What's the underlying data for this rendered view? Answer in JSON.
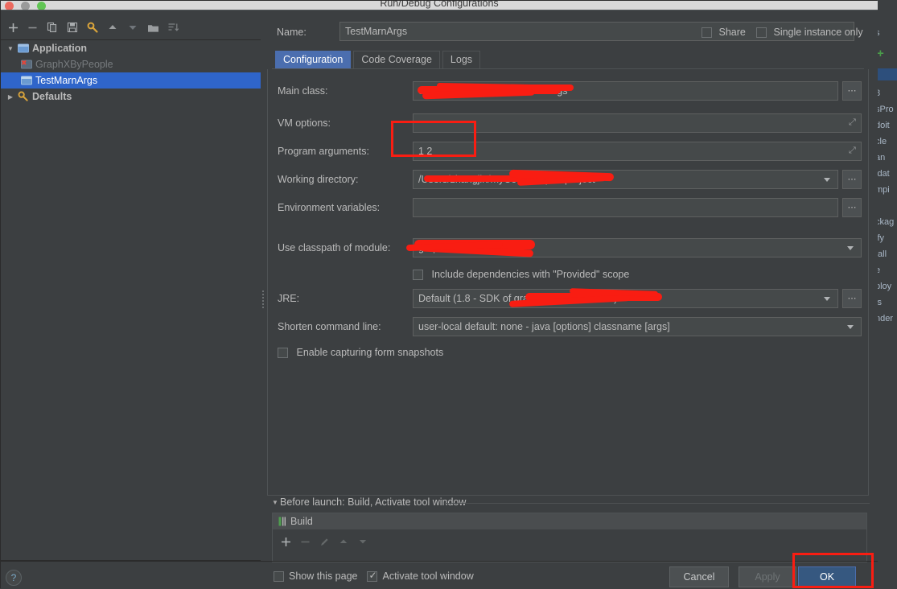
{
  "window": {
    "title": "Run/Debug Configurations",
    "traffic_lights": [
      "close-red",
      "minimize-disabled",
      "zoom-green"
    ]
  },
  "sidebar": {
    "toolbar": [
      {
        "name": "add-configuration-button",
        "glyph": "+"
      },
      {
        "name": "remove-configuration-button",
        "glyph": "−"
      },
      {
        "name": "copy-configuration-button",
        "glyph": "copy"
      },
      {
        "name": "save-configuration-button",
        "glyph": "save"
      },
      {
        "name": "edit-defaults-button",
        "glyph": "wrench"
      },
      {
        "name": "move-up-button",
        "glyph": "up"
      },
      {
        "name": "move-down-button",
        "glyph": "down"
      },
      {
        "name": "move-into-folder-button",
        "glyph": "folder"
      },
      {
        "name": "sort-configurations-button",
        "glyph": "sort"
      }
    ],
    "tree": [
      {
        "label": "Application",
        "level": 0,
        "expanded": true,
        "icon": "application-icon",
        "state": "normal"
      },
      {
        "label": "GraphXByPeople",
        "level": 1,
        "icon": "configuration-error-icon",
        "state": "disabled"
      },
      {
        "label": "TestMarnArgs",
        "level": 1,
        "icon": "configuration-icon",
        "state": "selected"
      },
      {
        "label": "Defaults",
        "level": 0,
        "expanded": false,
        "icon": "wrench-icon",
        "state": "normal"
      }
    ]
  },
  "header": {
    "name_label": "Name:",
    "name_value": "TestMarnArgs",
    "share_label": "Share",
    "share_checked": false,
    "single_instance_label": "Single instance only",
    "single_instance_checked": false
  },
  "tabs": [
    {
      "label": "Configuration",
      "active": true
    },
    {
      "label": "Code Coverage",
      "active": false
    },
    {
      "label": "Logs",
      "active": false
    }
  ],
  "form": {
    "main_class": {
      "label": "Main class:",
      "value": "cn.zhangjin.graphx.TestMarnArgs",
      "redacted": true
    },
    "vm_options": {
      "label": "VM options:",
      "value": ""
    },
    "program_arguments": {
      "label": "Program arguments:",
      "value": "1 2",
      "annotated": true
    },
    "working_directory": {
      "label": "Working directory:",
      "value": "/Users/zhangjin/myCode/graphx-project",
      "redacted": true
    },
    "environment_variables": {
      "label": "Environment variables:",
      "value": ""
    },
    "use_classpath_of_module": {
      "label": "Use classpath of module:",
      "value": "graphx-project",
      "redacted": true
    },
    "include_provided": {
      "label": "Include dependencies with \"Provided\" scope",
      "checked": false
    },
    "jre": {
      "label": "JRE:",
      "value": "Default (1.8 - SDK of graphx-project module)",
      "redacted": true
    },
    "shorten_command_line": {
      "label": "Shorten command line:",
      "value": "user-local default: none - java [options] classname [args]"
    },
    "enable_capturing": {
      "label": "Enable capturing form snapshots",
      "checked": false
    }
  },
  "before_launch": {
    "title": "Before launch: Build, Activate tool window",
    "items": [
      {
        "label": "Build",
        "icon": "build-icon"
      }
    ],
    "toolbar": [
      {
        "name": "add-task-button",
        "glyph": "+",
        "enabled": true
      },
      {
        "name": "remove-task-button",
        "glyph": "−",
        "enabled": false
      },
      {
        "name": "edit-task-button",
        "glyph": "pencil",
        "enabled": false
      },
      {
        "name": "move-task-up-button",
        "glyph": "up",
        "enabled": false
      },
      {
        "name": "move-task-down-button",
        "glyph": "down",
        "enabled": false
      }
    ],
    "show_this_page": {
      "label": "Show this page",
      "checked": false
    },
    "activate_tool_window": {
      "label": "Activate tool window",
      "checked": true
    }
  },
  "buttons": {
    "help": "?",
    "cancel": "Cancel",
    "apply": "Apply",
    "apply_enabled": false,
    "ok": "OK",
    "ok_annotated": true
  },
  "background_panel": {
    "name": "maven-lifecycle-panel",
    "plus_glyph": "+",
    "lines": [
      "8",
      "sPro",
      "doit",
      "cle",
      "an",
      "idat",
      "mpi",
      "t",
      "ckag",
      "ify",
      "tall",
      "e",
      "ploy",
      "is",
      "nder"
    ]
  },
  "colors": {
    "window_bg": "#3c3f41",
    "field_bg": "#45494a",
    "selection_blue": "#2f65ca",
    "tab_active": "#4b6eaf",
    "ok_button": "#365880",
    "annotation_red": "#f91d12",
    "text": "#bbbbbb"
  }
}
